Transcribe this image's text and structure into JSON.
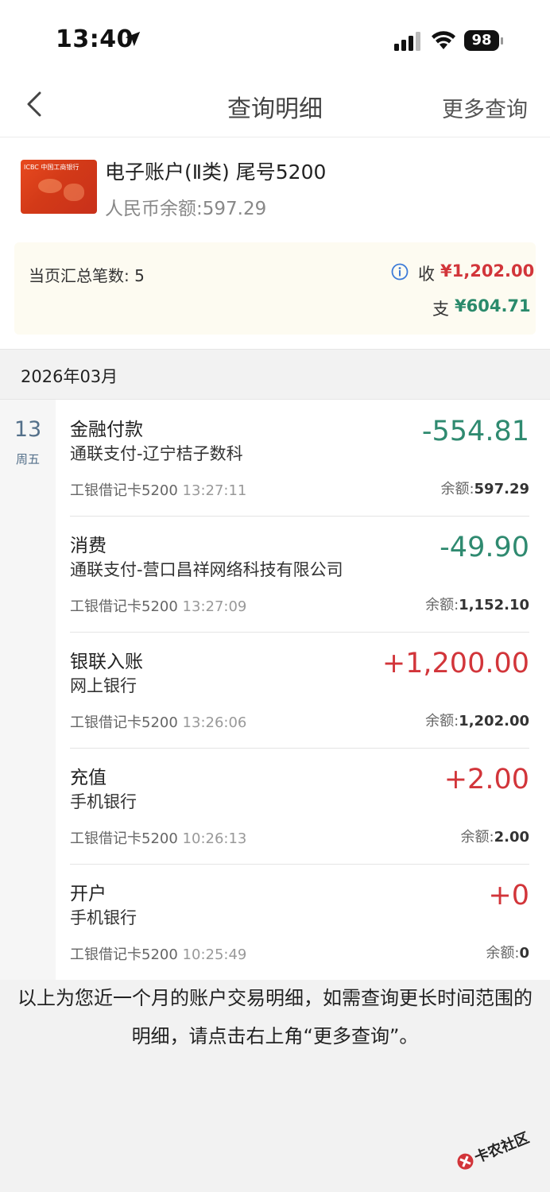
{
  "status_bar": {
    "time": "13:40",
    "battery": "98"
  },
  "nav": {
    "title": "查询明细",
    "more": "更多查询"
  },
  "account": {
    "name": "电子账户(Ⅱ类) 尾号5200",
    "balance": "人民币余额:597.29",
    "card_logo": "ICBC 中国工商银行"
  },
  "summary": {
    "count": "当页汇总笔数: 5",
    "income_label": "收",
    "income": "¥1,202.00",
    "expense_label": "支",
    "expense": "¥604.71",
    "colors": {
      "income": "#d2353a",
      "expense": "#2a8a6b"
    }
  },
  "month": "2026年03月",
  "date": {
    "day": "13",
    "weekday": "周五"
  },
  "transactions": [
    {
      "type": "金融付款",
      "desc": "通联支付-辽宁桔子数科",
      "card": "工银借记卡5200",
      "time": "13:27:11",
      "amount": "-554.81",
      "balance_label": "余额:",
      "balance": "597.29"
    },
    {
      "type": "消费",
      "desc": "通联支付-营口昌祥网络科技有限公司",
      "card": "工银借记卡5200",
      "time": "13:27:09",
      "amount": "-49.90",
      "balance_label": "余额:",
      "balance": "1,152.10"
    },
    {
      "type": "银联入账",
      "desc": "网上银行",
      "card": "工银借记卡5200",
      "time": "13:26:06",
      "amount": "+1,200.00",
      "balance_label": "余额:",
      "balance": "1,202.00"
    },
    {
      "type": "充值",
      "desc": "手机银行",
      "card": "工银借记卡5200",
      "time": "10:26:13",
      "amount": "+2.00",
      "balance_label": "余额:",
      "balance": "2.00"
    },
    {
      "type": "开户",
      "desc": "手机银行",
      "card": "工银借记卡5200",
      "time": "10:25:49",
      "amount": "+0",
      "balance_label": "余额:",
      "balance": "0"
    }
  ],
  "footer_note": "以上为您近一个月的账户交易明细，如需查询更长时间范围的明细，请点击右上角“更多查询”。",
  "watermark": "卡农社区"
}
